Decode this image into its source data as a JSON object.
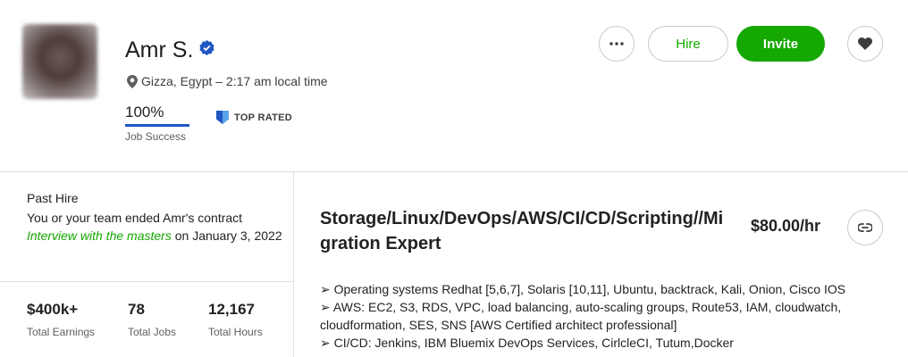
{
  "profile": {
    "name": "Amr S.",
    "location": "Gizza, Egypt – 2:17 am local time",
    "job_success_value": "100%",
    "job_success_label": "Job Success",
    "job_success_fraction": 1.0,
    "badge": "TOP RATED"
  },
  "actions": {
    "hire_label": "Hire",
    "invite_label": "Invite"
  },
  "past_hire": {
    "title": "Past Hire",
    "text_prefix": "You or your team ended Amr's contract",
    "link_text": "Interview with the masters",
    "text_suffix": " on January 3, 2022"
  },
  "stats": [
    {
      "value": "$400k+",
      "label": "Total Earnings"
    },
    {
      "value": "78",
      "label": "Total Jobs"
    },
    {
      "value": "12,167",
      "label": "Total Hours"
    }
  ],
  "job": {
    "title": "Storage/Linux/DevOps/AWS/CI/CD/Scripting//Migration Expert",
    "rate": "$80.00/hr",
    "description_lines": [
      "➢ Operating systems Redhat [5,6,7], Solaris [10,11], Ubuntu, backtrack, Kali, Onion, Cisco IOS",
      "➢ AWS: EC2, S3, RDS, VPC, load balancing, auto-scaling groups, Route53, IAM, cloudwatch,",
      "cloudformation, SES, SNS [AWS Certified architect professional]",
      "➢ CI/CD: Jenkins, IBM Bluemix DevOps Services, CirlcleCI, Tutum,Docker"
    ]
  },
  "colors": {
    "brand_green": "#14a800",
    "job_success_blue": "#1f57c3",
    "verified_blue": "#1f57c3",
    "top_rated_blue": "#1f57c3"
  }
}
